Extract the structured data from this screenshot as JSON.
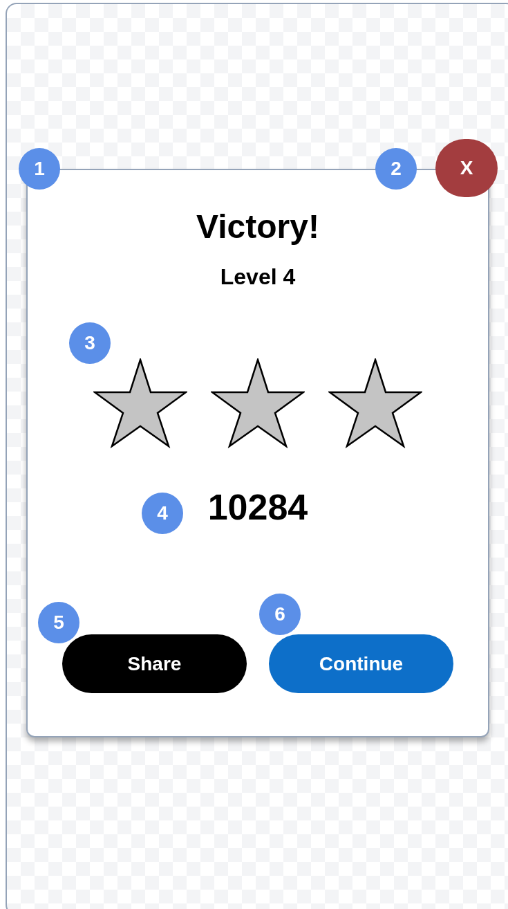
{
  "dialog": {
    "title": "Victory!",
    "subtitle": "Level 4",
    "stars": 0,
    "score": "10284",
    "close": "X",
    "buttons": [
      {
        "kind": "secondary",
        "label": "Share"
      },
      {
        "kind": "primary",
        "label": "Continue"
      }
    ]
  },
  "markers": [
    "1",
    "2",
    "3",
    "4",
    "5",
    "6"
  ]
}
